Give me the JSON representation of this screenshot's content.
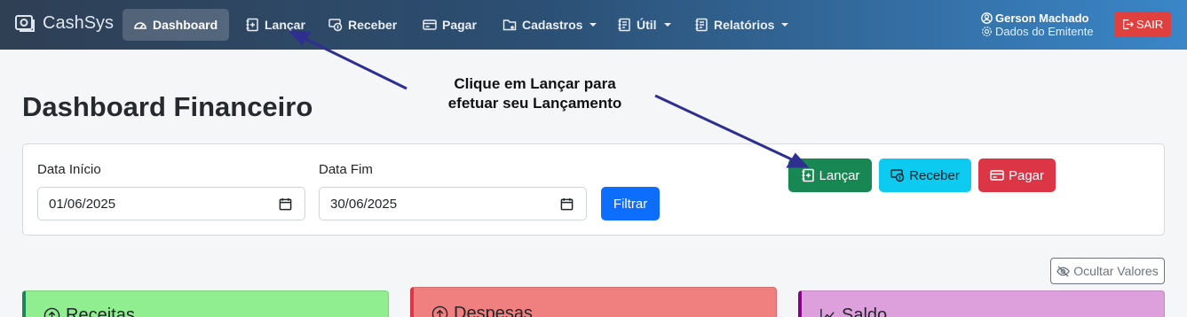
{
  "navbar": {
    "brand": "CashSys",
    "items": [
      {
        "label": "Dashboard",
        "icon": "speedometer-icon"
      },
      {
        "label": "Lançar",
        "icon": "journal-plus-icon"
      },
      {
        "label": "Receber",
        "icon": "cash-coin-icon"
      },
      {
        "label": "Pagar",
        "icon": "credit-card-icon"
      },
      {
        "label": "Cadastros",
        "icon": "folder-plus-icon"
      },
      {
        "label": "Útil",
        "icon": "journal-text-icon"
      },
      {
        "label": "Relatórios",
        "icon": "journal-text-icon"
      }
    ],
    "user_name": "Gerson Machado",
    "user_subtitle": "Dados do Emitente",
    "logout_label": "SAIR"
  },
  "page": {
    "title": "Dashboard Financeiro",
    "callout_line1": "Clique em Lançar para",
    "callout_line2": "efetuar seu Lançamento"
  },
  "filter": {
    "start_label": "Data Início",
    "start_value": "01/06/2025",
    "end_label": "Data Fim",
    "end_value": "30/06/2025",
    "filter_button": "Filtrar"
  },
  "actions": {
    "lancar": "Lançar",
    "receber": "Receber",
    "pagar": "Pagar"
  },
  "toggle_values_label": "Ocultar Valores",
  "summary": {
    "receitas": "Receitas",
    "despesas": "Despesas",
    "saldo": "Saldo"
  },
  "colors": {
    "arrow": "#2e2f8f",
    "success": "#198754",
    "info": "#0dcaf0",
    "danger": "#dc3545",
    "primary": "#0d6efd"
  }
}
